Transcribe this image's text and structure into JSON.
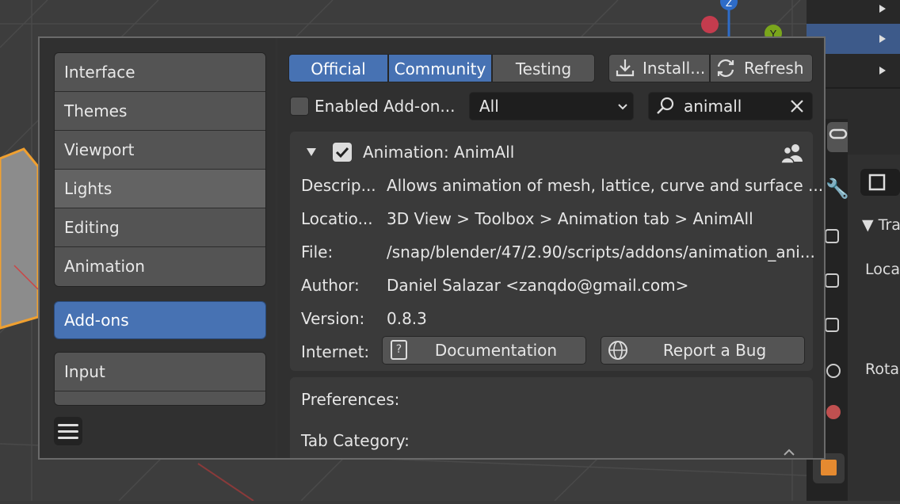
{
  "colors": {
    "accent": "#4772b3",
    "button": "#545454",
    "field": "#1e1e1e",
    "panel": "#303030"
  },
  "viewport": {
    "gizmo_z": "Z",
    "gizmo_y": "Y"
  },
  "properties": {
    "transform_label": "Tra",
    "location_label": "Loca",
    "rotation_label": "Rota"
  },
  "sidebar": {
    "items": [
      "Interface",
      "Themes",
      "Viewport",
      "Lights",
      "Editing",
      "Animation"
    ],
    "hover_item": "Lights",
    "active_item": "Add-ons",
    "lower_items": [
      "Input"
    ]
  },
  "tabs": {
    "official": "Official",
    "community": "Community",
    "testing": "Testing"
  },
  "toolbar": {
    "install": "Install...",
    "refresh": "Refresh"
  },
  "filter": {
    "enabled_label": "Enabled Add-on...",
    "category": "All",
    "search_value": "animall"
  },
  "addon": {
    "name": "Animation: AnimAll",
    "enabled": true,
    "description_label": "Descrip...",
    "description": "Allows animation of mesh, lattice, curve and surface ...",
    "location_label": "Locatio...",
    "location": "3D View > Toolbox > Animation tab > AnimAll",
    "file_label": "File:",
    "file": "/snap/blender/47/2.90/scripts/addons/animation_ani...",
    "author_label": "Author:",
    "author": "Daniel Salazar <zanqdo@gmail.com>",
    "version_label": "Version:",
    "version": "0.8.3",
    "internet_label": "Internet:",
    "documentation": "Documentation",
    "report_bug": "Report a Bug"
  },
  "preferences": {
    "title": "Preferences:",
    "tab_category": "Tab Category:"
  }
}
